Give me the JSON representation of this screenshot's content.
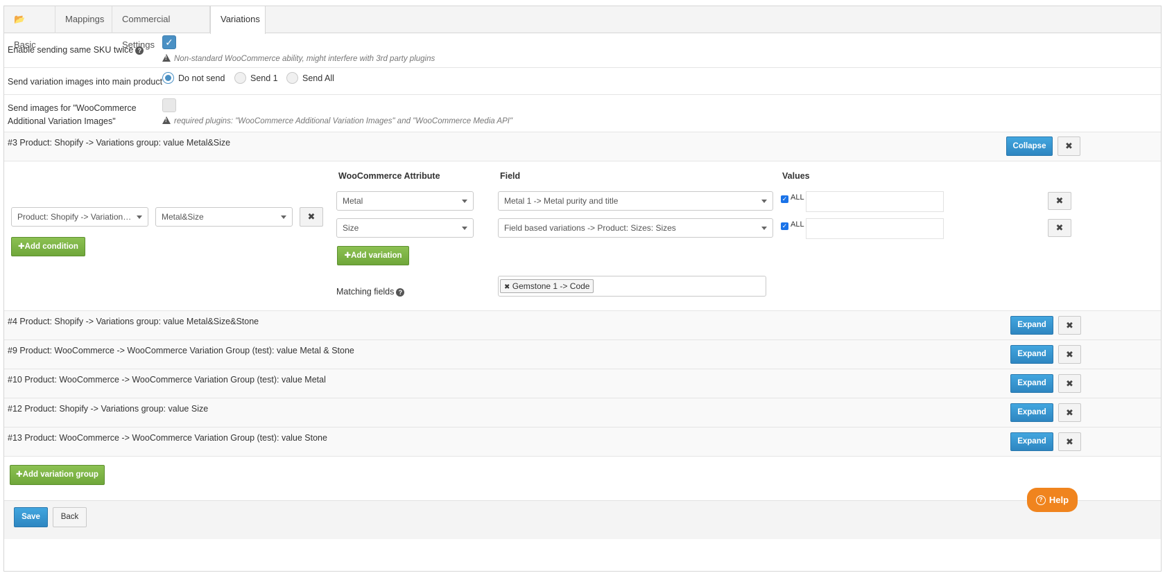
{
  "tabs": [
    {
      "label": "Basic",
      "icon": "folder-open-icon"
    },
    {
      "label": "Mappings"
    },
    {
      "label": "Commercial Settings"
    },
    {
      "label": "Variations"
    }
  ],
  "settings": {
    "sku_twice": {
      "label": "Enable sending same SKU twice",
      "checked": true,
      "note": "Non-standard WooCommerce ability, might interfere with 3rd party plugins"
    },
    "variation_images": {
      "label": "Send variation images into main product",
      "options": [
        "Do not send",
        "Send 1",
        "Send All"
      ],
      "selected": "Do not send"
    },
    "additional_images": {
      "label_line1": "Send images for \"WooCommerce",
      "label_line2": "Additional Variation Images\"",
      "checked": false,
      "note": "required plugins: \"WooCommerce Additional Variation Images\" and \"WooCommerce Media API\""
    }
  },
  "expanded_group": {
    "title": "#3  Product: Shopify -> Variations group: value Metal&Size",
    "collapse_label": "Collapse",
    "condition": {
      "field": "Product: Shopify -> Variations ...",
      "value": "Metal&Size",
      "add_label": "Add condition"
    },
    "columns": {
      "attribute": "WooCommerce Attribute",
      "field": "Field",
      "values": "Values"
    },
    "variations": [
      {
        "attribute": "Metal",
        "field": "Metal 1 -> Metal purity and title",
        "all_label": "ALL",
        "all_checked": true
      },
      {
        "attribute": "Size",
        "field": "Field based variations -> Product: Sizes: Sizes",
        "all_label": "ALL",
        "all_checked": true
      }
    ],
    "add_variation_label": "Add variation",
    "matching_label": "Matching fields",
    "matching_tags": [
      "Gemstone 1 -> Code"
    ]
  },
  "collapsed_groups": [
    {
      "title": "#4  Product: Shopify -> Variations group: value Metal&Size&Stone",
      "button": "Expand"
    },
    {
      "title": "#9  Product: WooCommerce -> WooCommerce Variation Group (test): value Metal & Stone",
      "button": "Expand"
    },
    {
      "title": "#10  Product: WooCommerce -> WooCommerce Variation Group (test): value Metal",
      "button": "Expand"
    },
    {
      "title": "#12  Product: Shopify -> Variations group: value Size",
      "button": "Expand"
    },
    {
      "title": "#13  Product: WooCommerce -> WooCommerce Variation Group (test): value Stone",
      "button": "Expand"
    }
  ],
  "add_group_label": "Add variation group",
  "footer": {
    "save": "Save",
    "back": "Back"
  },
  "help": "Help",
  "colors": {
    "primary": "#3a9ad6",
    "success": "#7cb342",
    "help": "#f0841e"
  }
}
